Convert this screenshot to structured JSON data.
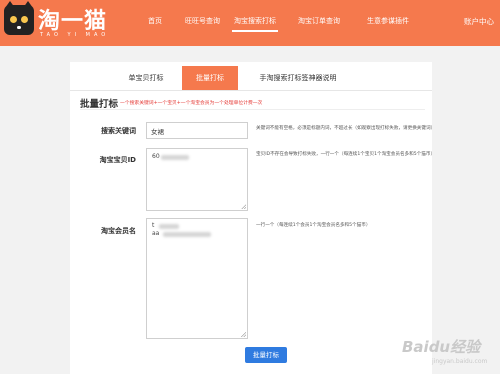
{
  "brand": {
    "name": "淘一猫",
    "sub": "TAO YI MAO"
  },
  "nav": {
    "items": [
      {
        "label": "首页",
        "active": false
      },
      {
        "label": "旺旺号查询",
        "active": false
      },
      {
        "label": "淘宝搜索打标",
        "active": true
      },
      {
        "label": "淘宝订单查询",
        "active": false
      },
      {
        "label": "生意参谋插件",
        "active": false
      }
    ],
    "user": "账户中心"
  },
  "tabs": [
    {
      "label": "单宝贝打标",
      "active": false
    },
    {
      "label": "批量打标",
      "active": true
    },
    {
      "label": "手淘搜索打标签神器说明",
      "active": false
    }
  ],
  "form": {
    "title": "批量打标",
    "hint": "一个搜索关键词+一个宝贝+一个淘宝会员为一个处理单位计费一次",
    "keyword": {
      "label": "搜索关键词",
      "value": "女裙",
      "help": "关键词不能有空格，必须是标题内词，不超过长（如观察出现打标失败，请更换关键词）"
    },
    "item_id": {
      "label": "淘宝宝贝ID",
      "value_prefix": "60",
      "help": "宝贝ID不存在会导致打标失败，一行一个（每连续1个宝贝1个淘宝会员名多和5个猫币）"
    },
    "member": {
      "label": "淘宝会员名",
      "value_prefix_1": "t",
      "value_prefix_2": "aa",
      "help": "一行一个（每连续1个会员1个淘宝会员名多和5个猫币）"
    },
    "submit": "批量打标"
  },
  "watermark": {
    "main": "Baidu经验",
    "sub": "jingyan.baidu.com"
  }
}
